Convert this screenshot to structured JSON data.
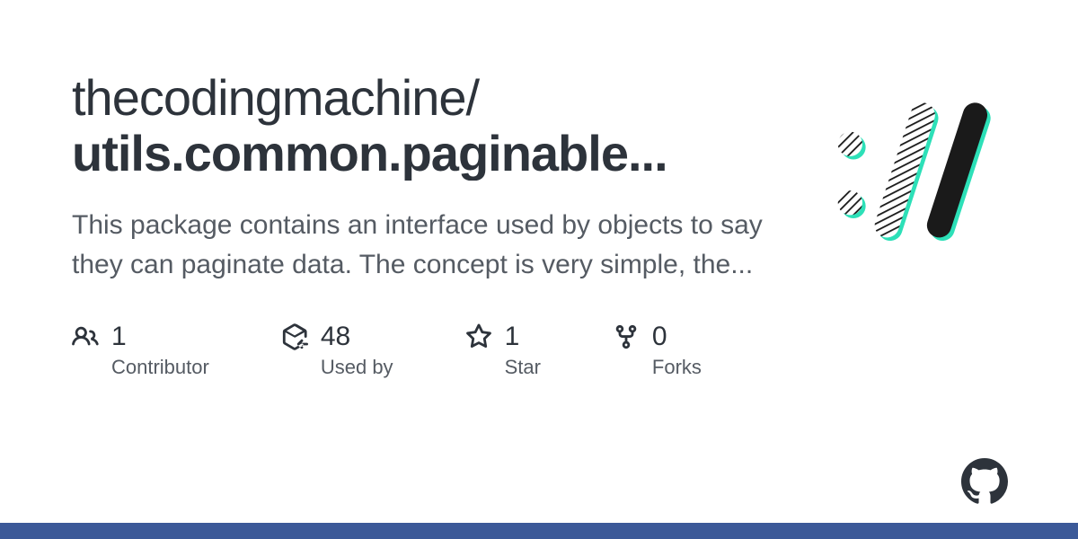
{
  "repo": {
    "owner": "thecodingmachine",
    "name": "utils.common.paginable...",
    "description": "This package contains an interface used by objects to say they can paginate data. The concept is very simple, the..."
  },
  "stats": {
    "contributors": {
      "value": "1",
      "label": "Contributor"
    },
    "usedby": {
      "value": "48",
      "label": "Used by"
    },
    "stars": {
      "value": "1",
      "label": "Star"
    },
    "forks": {
      "value": "0",
      "label": "Forks"
    }
  }
}
